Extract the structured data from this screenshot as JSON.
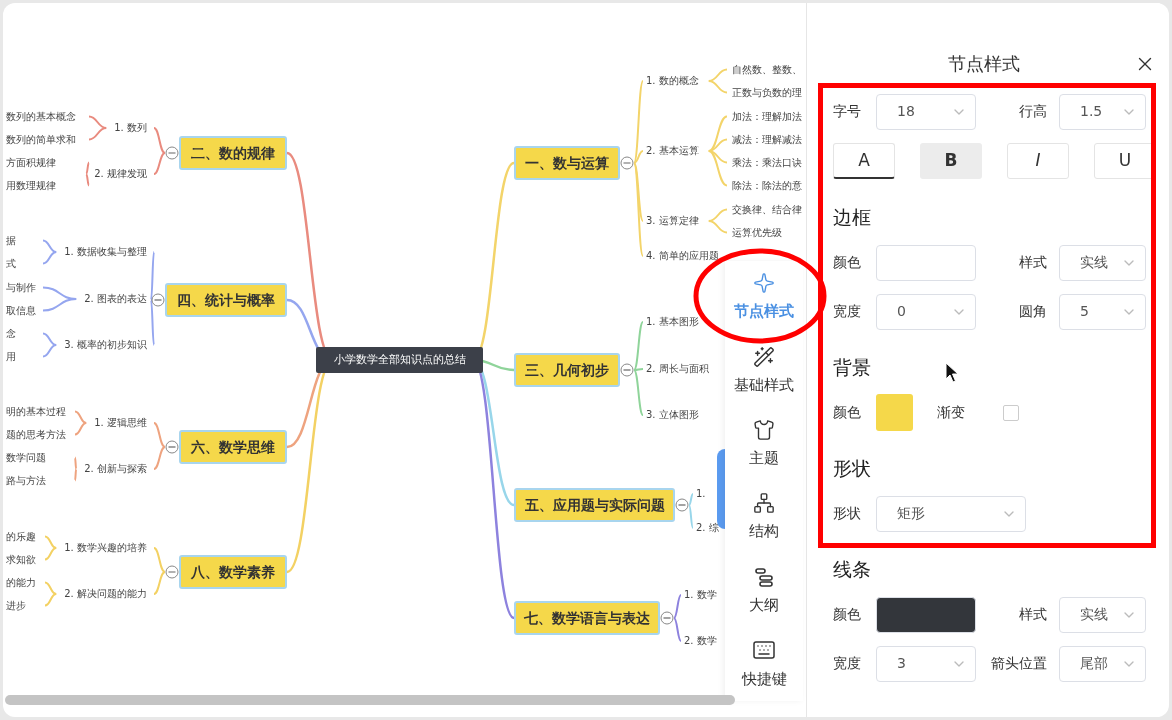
{
  "mindmap": {
    "root": "小学数学全部知识点的总结",
    "branches": [
      {
        "label": "一、数与运算",
        "color": "#f3d46a",
        "expanded": true,
        "children": [
          {
            "label": "1. 数的概念",
            "children": [
              {
                "label": "自然数、整数、"
              },
              {
                "label": "正数与负数的理"
              }
            ]
          },
          {
            "label": "2. 基本运算",
            "children": [
              {
                "label": "加法：理解加法"
              },
              {
                "label": "减法：理解减法"
              },
              {
                "label": "乘法：乘法口诀"
              },
              {
                "label": "除法：除法的意"
              }
            ]
          },
          {
            "label": "3. 运算定律",
            "children": [
              {
                "label": "交换律、结合律"
              },
              {
                "label": "运算优先级"
              }
            ]
          },
          {
            "label": "4. 简单的应用题"
          }
        ]
      },
      {
        "label": "二、数的规律",
        "color": "#e98b7f",
        "expanded": true,
        "children": [
          {
            "label": "1. 数列",
            "children": [
              {
                "label": "数列的基本概念"
              },
              {
                "label": "数列的简单求和"
              }
            ]
          },
          {
            "label": "2. 规律发现",
            "children": [
              {
                "label": "方面积规律"
              },
              {
                "label": "用数理规律"
              }
            ]
          }
        ]
      },
      {
        "label": "三、几何初步",
        "color": "#8fd49a",
        "expanded": true,
        "children": [
          {
            "label": "1. 基本图形"
          },
          {
            "label": "2. 周长与面积"
          },
          {
            "label": "3. 立体图形"
          }
        ]
      },
      {
        "label": "四、统计与概率",
        "color": "#95a6ef",
        "expanded": true,
        "children": [
          {
            "label": "1. 数据收集与整理",
            "children": [
              {
                "label": "据"
              },
              {
                "label": "式"
              }
            ]
          },
          {
            "label": "2. 图表的表达",
            "children": [
              {
                "label": "与制作"
              },
              {
                "label": "取信息"
              }
            ]
          },
          {
            "label": "3. 概率的初步知识",
            "children": [
              {
                "label": "念"
              },
              {
                "label": "用"
              }
            ]
          }
        ]
      },
      {
        "label": "五、应用题与实际问题",
        "color": "#98d6ea",
        "expanded": true,
        "children": [
          {
            "label": "1."
          },
          {
            "label": "2. 综"
          }
        ]
      },
      {
        "label": "六、数学思维",
        "color": "#eea37f",
        "expanded": true,
        "children": [
          {
            "label": "1. 逻辑思维",
            "children": [
              {
                "label": "明的基本过程"
              },
              {
                "label": "题的思考方法"
              }
            ]
          },
          {
            "label": "2. 创新与探索",
            "children": [
              {
                "label": "数学问题"
              },
              {
                "label": "路与方法"
              }
            ]
          }
        ]
      },
      {
        "label": "七、数学语言与表达",
        "color": "#8d82de",
        "expanded": true,
        "children": [
          {
            "label": "1. 数学"
          },
          {
            "label": "2. 数学"
          }
        ]
      },
      {
        "label": "八、数学素养",
        "color": "#f3d163",
        "expanded": true,
        "children": [
          {
            "label": "1. 数学兴趣的培养",
            "children": [
              {
                "label": "的乐趣"
              },
              {
                "label": "求知欲"
              }
            ]
          },
          {
            "label": "2. 解决问题的能力",
            "children": [
              {
                "label": "的能力"
              },
              {
                "label": "进步"
              }
            ]
          }
        ]
      }
    ]
  },
  "toolbar": [
    {
      "label": "节点样式",
      "selected": true
    },
    {
      "label": "基础样式",
      "selected": false
    },
    {
      "label": "主题",
      "selected": false
    },
    {
      "label": "结构",
      "selected": false
    },
    {
      "label": "大纲",
      "selected": false
    },
    {
      "label": "快捷键",
      "selected": false
    }
  ],
  "panel": {
    "title": "节点样式",
    "sections": [
      {
        "rows": [
          {
            "kind": "pair",
            "fields": [
              {
                "label": "字号",
                "kind": "select",
                "value": "18"
              },
              {
                "label": "行高",
                "kind": "select",
                "value": "1.5"
              }
            ]
          },
          {
            "kind": "format",
            "buttons": [
              {
                "label": "A",
                "selected": true,
                "pressed": false
              },
              {
                "label": "B",
                "selected": false,
                "pressed": true
              },
              {
                "label": "I",
                "selected": false,
                "pressed": false
              },
              {
                "label": "U",
                "selected": false,
                "pressed": false
              }
            ]
          }
        ]
      },
      {
        "heading": "边框",
        "rows": [
          {
            "kind": "pair",
            "fields": [
              {
                "label": "颜色",
                "kind": "color",
                "color": "#ffffff"
              },
              {
                "label": "样式",
                "kind": "select",
                "value": "实线"
              }
            ]
          },
          {
            "kind": "pair",
            "fields": [
              {
                "label": "宽度",
                "kind": "select",
                "value": "0"
              },
              {
                "label": "圆角",
                "kind": "select",
                "value": "5"
              }
            ]
          }
        ]
      },
      {
        "heading": "背景",
        "rows": [
          {
            "kind": "pair",
            "fields": [
              {
                "label": "颜色",
                "kind": "swatch",
                "color": "#f5d84a"
              },
              {
                "label": "渐变",
                "kind": "checkbox",
                "checked": false
              }
            ]
          }
        ]
      },
      {
        "heading": "形状",
        "rows": [
          {
            "kind": "pair",
            "fields": [
              {
                "label": "形状",
                "kind": "wide-select",
                "value": "矩形"
              }
            ]
          }
        ]
      },
      {
        "heading": "线条",
        "rows": [
          {
            "kind": "pair",
            "fields": [
              {
                "label": "颜色",
                "kind": "color",
                "color": "#33363b"
              },
              {
                "label": "样式",
                "kind": "select",
                "value": "实线"
              }
            ]
          },
          {
            "kind": "pair",
            "fields": [
              {
                "label": "宽度",
                "kind": "select",
                "value": "3"
              },
              {
                "label": "箭头位置",
                "kind": "select",
                "value": "尾部"
              }
            ]
          }
        ]
      }
    ]
  }
}
